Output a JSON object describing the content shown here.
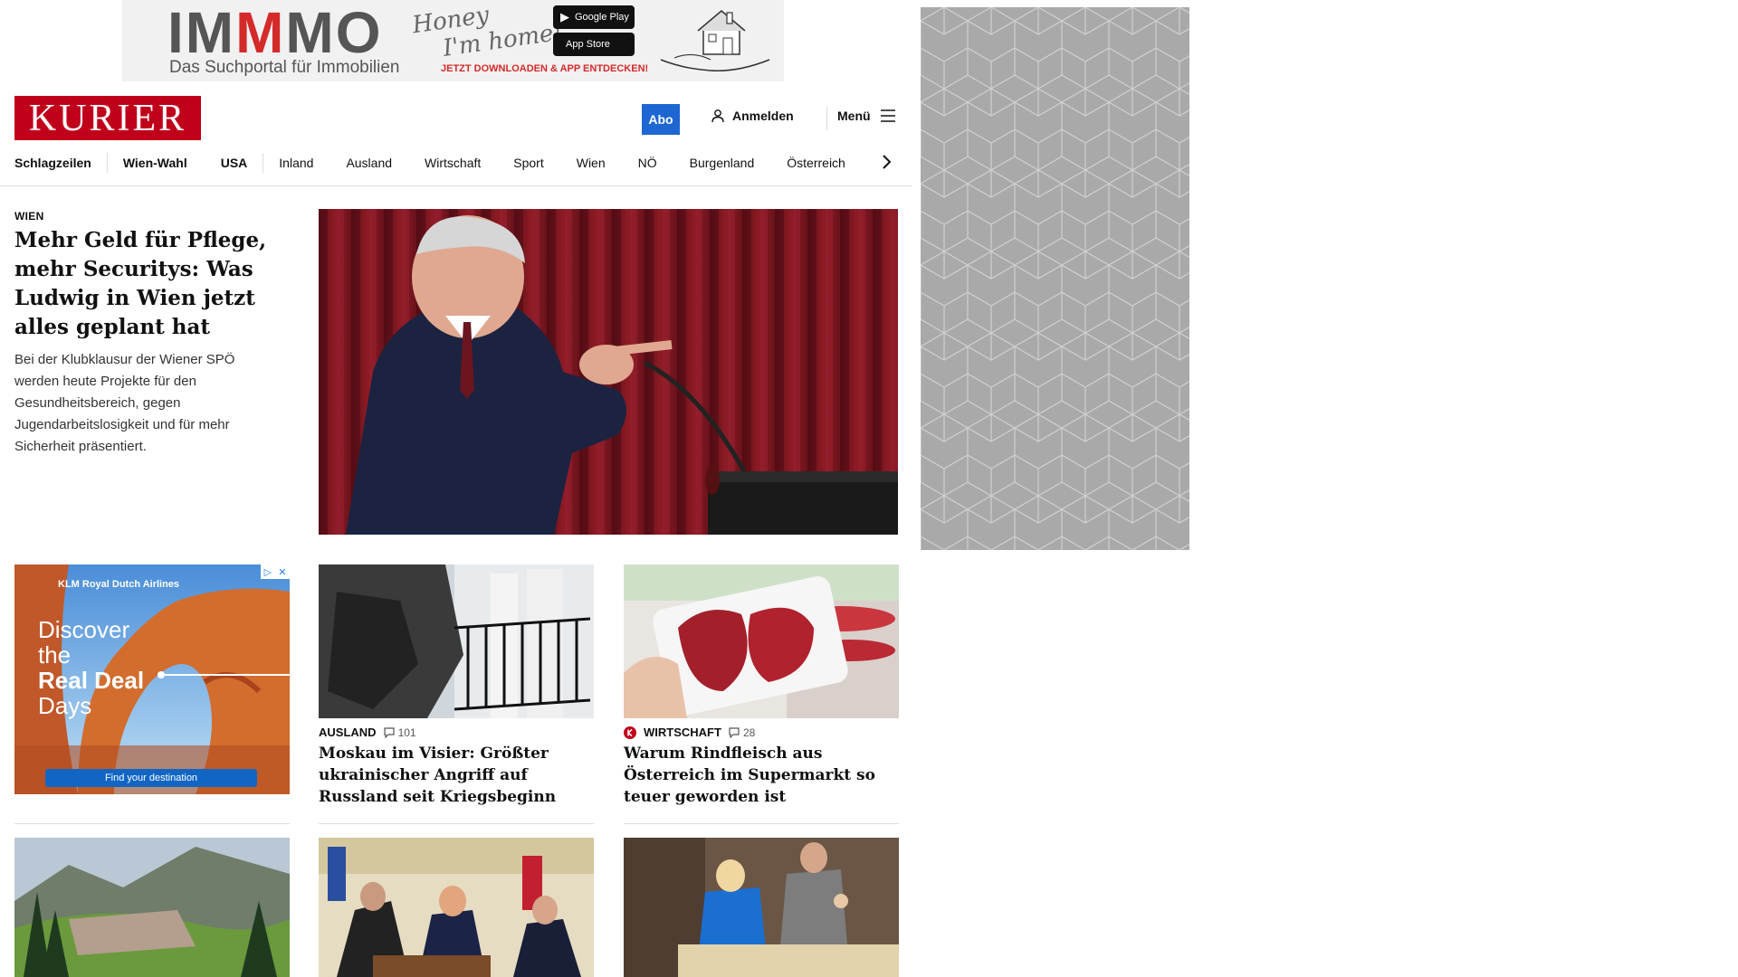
{
  "top_ad": {
    "brand_part1": "IM",
    "brand_part2": "M",
    "brand_part3": "MO",
    "tagline": "Das Suchportal für Immobilien",
    "script_line1": "Honey",
    "script_line2": "I'm home!",
    "google_play": "Google Play",
    "app_store": "App Store",
    "cta": "JETZT DOWNLOADEN & APP ENTDECKEN!"
  },
  "header": {
    "logo": "KURIER",
    "abo_label": "Abo",
    "login_label": "Anmelden",
    "menu_label": "Menü"
  },
  "nav": {
    "items": [
      "Schlagzeilen",
      "Wien-Wahl",
      "USA",
      "Inland",
      "Ausland",
      "Wirtschaft",
      "Sport",
      "Wien",
      "NÖ",
      "Burgenland",
      "Österreich"
    ]
  },
  "lead": {
    "kicker": "WIEN",
    "title": "Mehr Geld für Pflege, mehr Securitys: Was Ludwig in Wien jetzt alles geplant hat",
    "teaser": "Bei der Klubklausur der Wiener SPÖ werden heute Projekte für den Gesundheitsbereich, gegen Jugendarbeitslosigkeit und für mehr Sicherheit präsentiert."
  },
  "klm_ad": {
    "brand": "KLM Royal Dutch Airlines",
    "line1": "Discover",
    "line2": "the",
    "line3": "Real Deal",
    "line4": "Days",
    "cta": "Find your destination"
  },
  "cards": [
    {
      "category": "AUSLAND",
      "comments": "101",
      "title": "Moskau im Visier: Größter ukrainischer Angriff auf Russland seit Kriegsbeginn"
    },
    {
      "category": "WIRTSCHAFT",
      "comments": "28",
      "title": "Warum Rindfleisch aus Österreich im Supermarkt so teuer geworden ist"
    }
  ],
  "colors": {
    "brand_red": "#c0001a",
    "abo_blue": "#1e66d1",
    "side_ad_gray": "#a9a9a9"
  }
}
